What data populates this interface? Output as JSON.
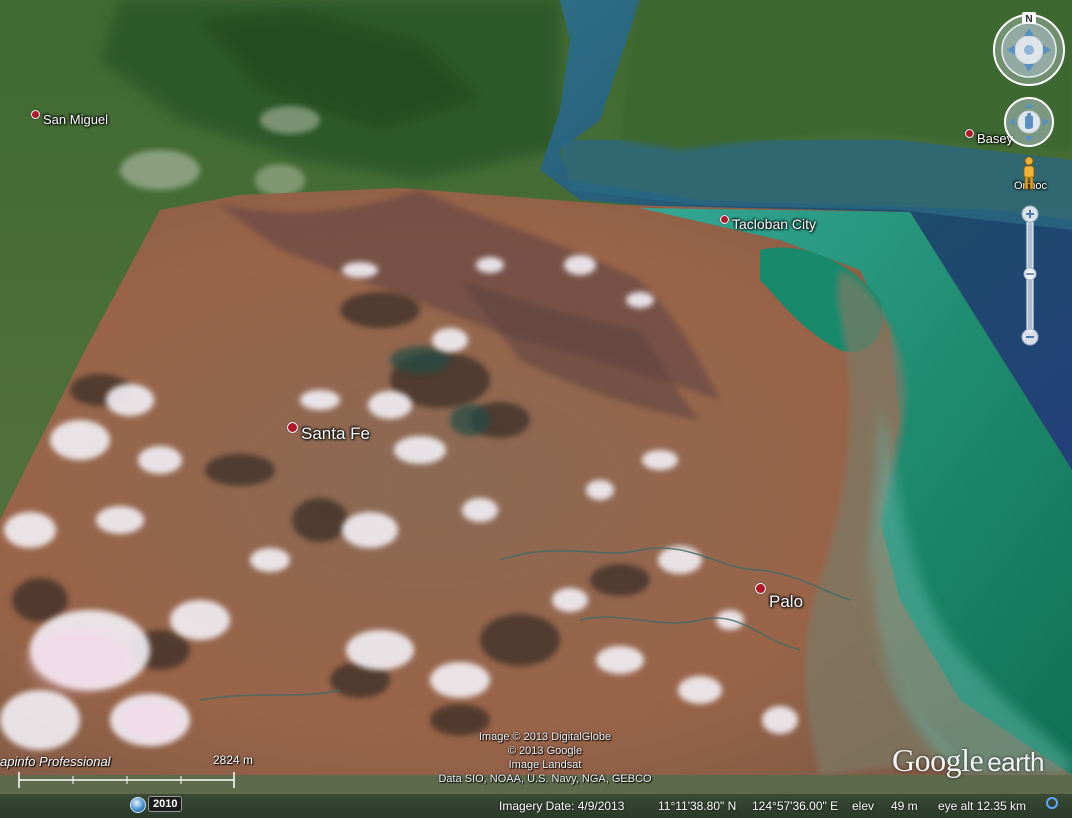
{
  "labels": {
    "san_miguel": "San Miguel",
    "basey": "Basey",
    "ormoc": "Ormoc",
    "tacloban": "Tacloban City",
    "santa_fe": "Santa Fe",
    "palo": "Palo"
  },
  "attribution": {
    "line1": "Image © 2013 DigitalGlobe",
    "line2": "© 2013 Google",
    "line3": "Image Landsat",
    "line4": "Data SIO, NOAA, U.S. Navy, NGA, GEBCO"
  },
  "overlay_credit": "apinfo Professional",
  "logo": {
    "google": "Google",
    "earth": "earth"
  },
  "scale_label": "2824 m",
  "compass_north": "N",
  "status": {
    "year": "2010",
    "imagery_date": "Imagery Date: 4/9/2013",
    "latitude": "11°11'38.80\" N",
    "longitude": "124°57'36.00\" E",
    "elev_label": "elev",
    "elev_value": "49 m",
    "eye_alt": "eye alt  12.35 km"
  },
  "icons": {
    "compass": "compass-ring-icon",
    "pan": "pan-hand-icon",
    "pegman": "street-view-pegman-icon",
    "zoom_in": "plus-icon",
    "zoom_out": "minus-icon",
    "historic": "historic-imagery-clock-icon",
    "stream": "streaming-indicator-icon"
  },
  "colors": {
    "pin": "#b0182a",
    "sea": "#1c5a74",
    "overlay_water": "#1fa58a",
    "overlay_land": "#9a6448"
  }
}
